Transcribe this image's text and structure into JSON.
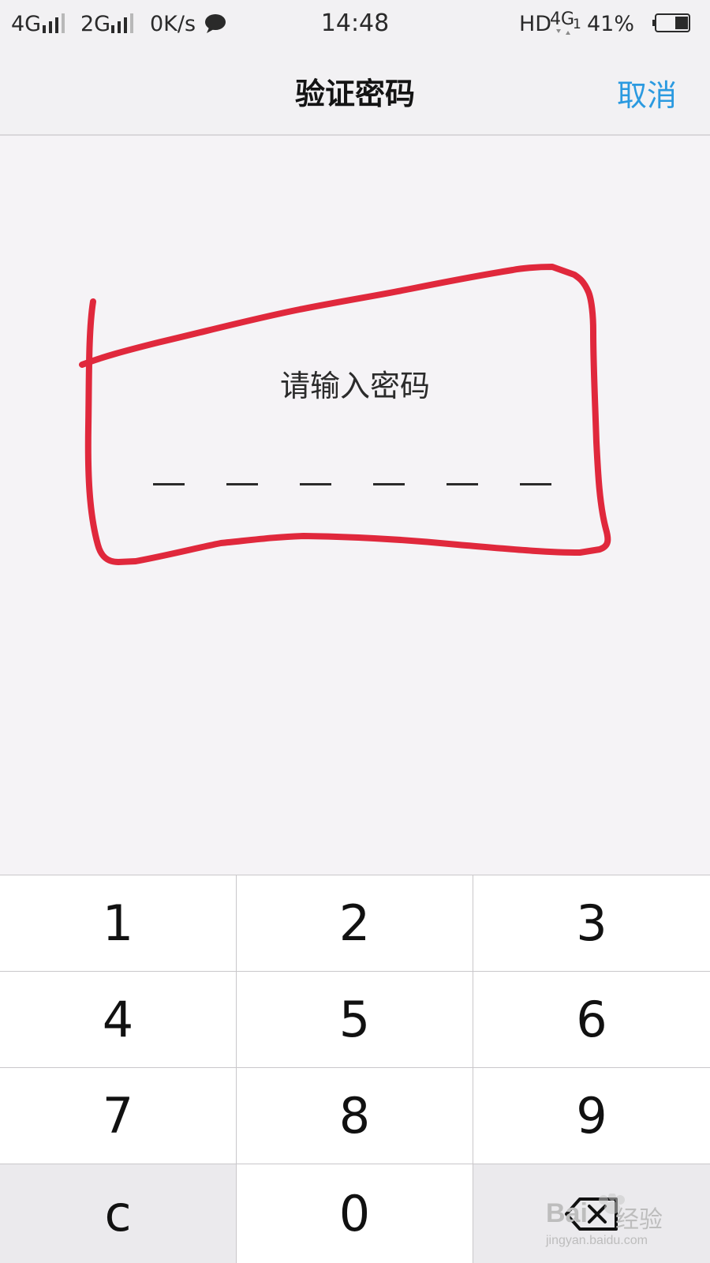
{
  "status_bar": {
    "network1": "4G",
    "network2": "2G",
    "speed": "0K/s",
    "time": "14:48",
    "hd": "HD",
    "net_right": "4G",
    "net_right_sub": "1",
    "battery": "41%",
    "battery_level": 0.41
  },
  "nav": {
    "title": "验证密码",
    "cancel": "取消"
  },
  "prompt": {
    "label": "请输入密码",
    "pin_length": 6,
    "entered": 0
  },
  "keypad": {
    "keys": [
      "1",
      "2",
      "3",
      "4",
      "5",
      "6",
      "7",
      "8",
      "9",
      "c",
      "0"
    ],
    "backspace_icon": "backspace-icon"
  },
  "watermark": {
    "brand": "Bai",
    "brand2": "经验",
    "url": "jingyan.baidu.com"
  },
  "colors": {
    "accent": "#2b9ae0",
    "annotation": "#e0283c",
    "keypad_bg": "#ffffff",
    "keypad_gray": "#ebeaed",
    "page_bg": "#f5f3f6"
  }
}
